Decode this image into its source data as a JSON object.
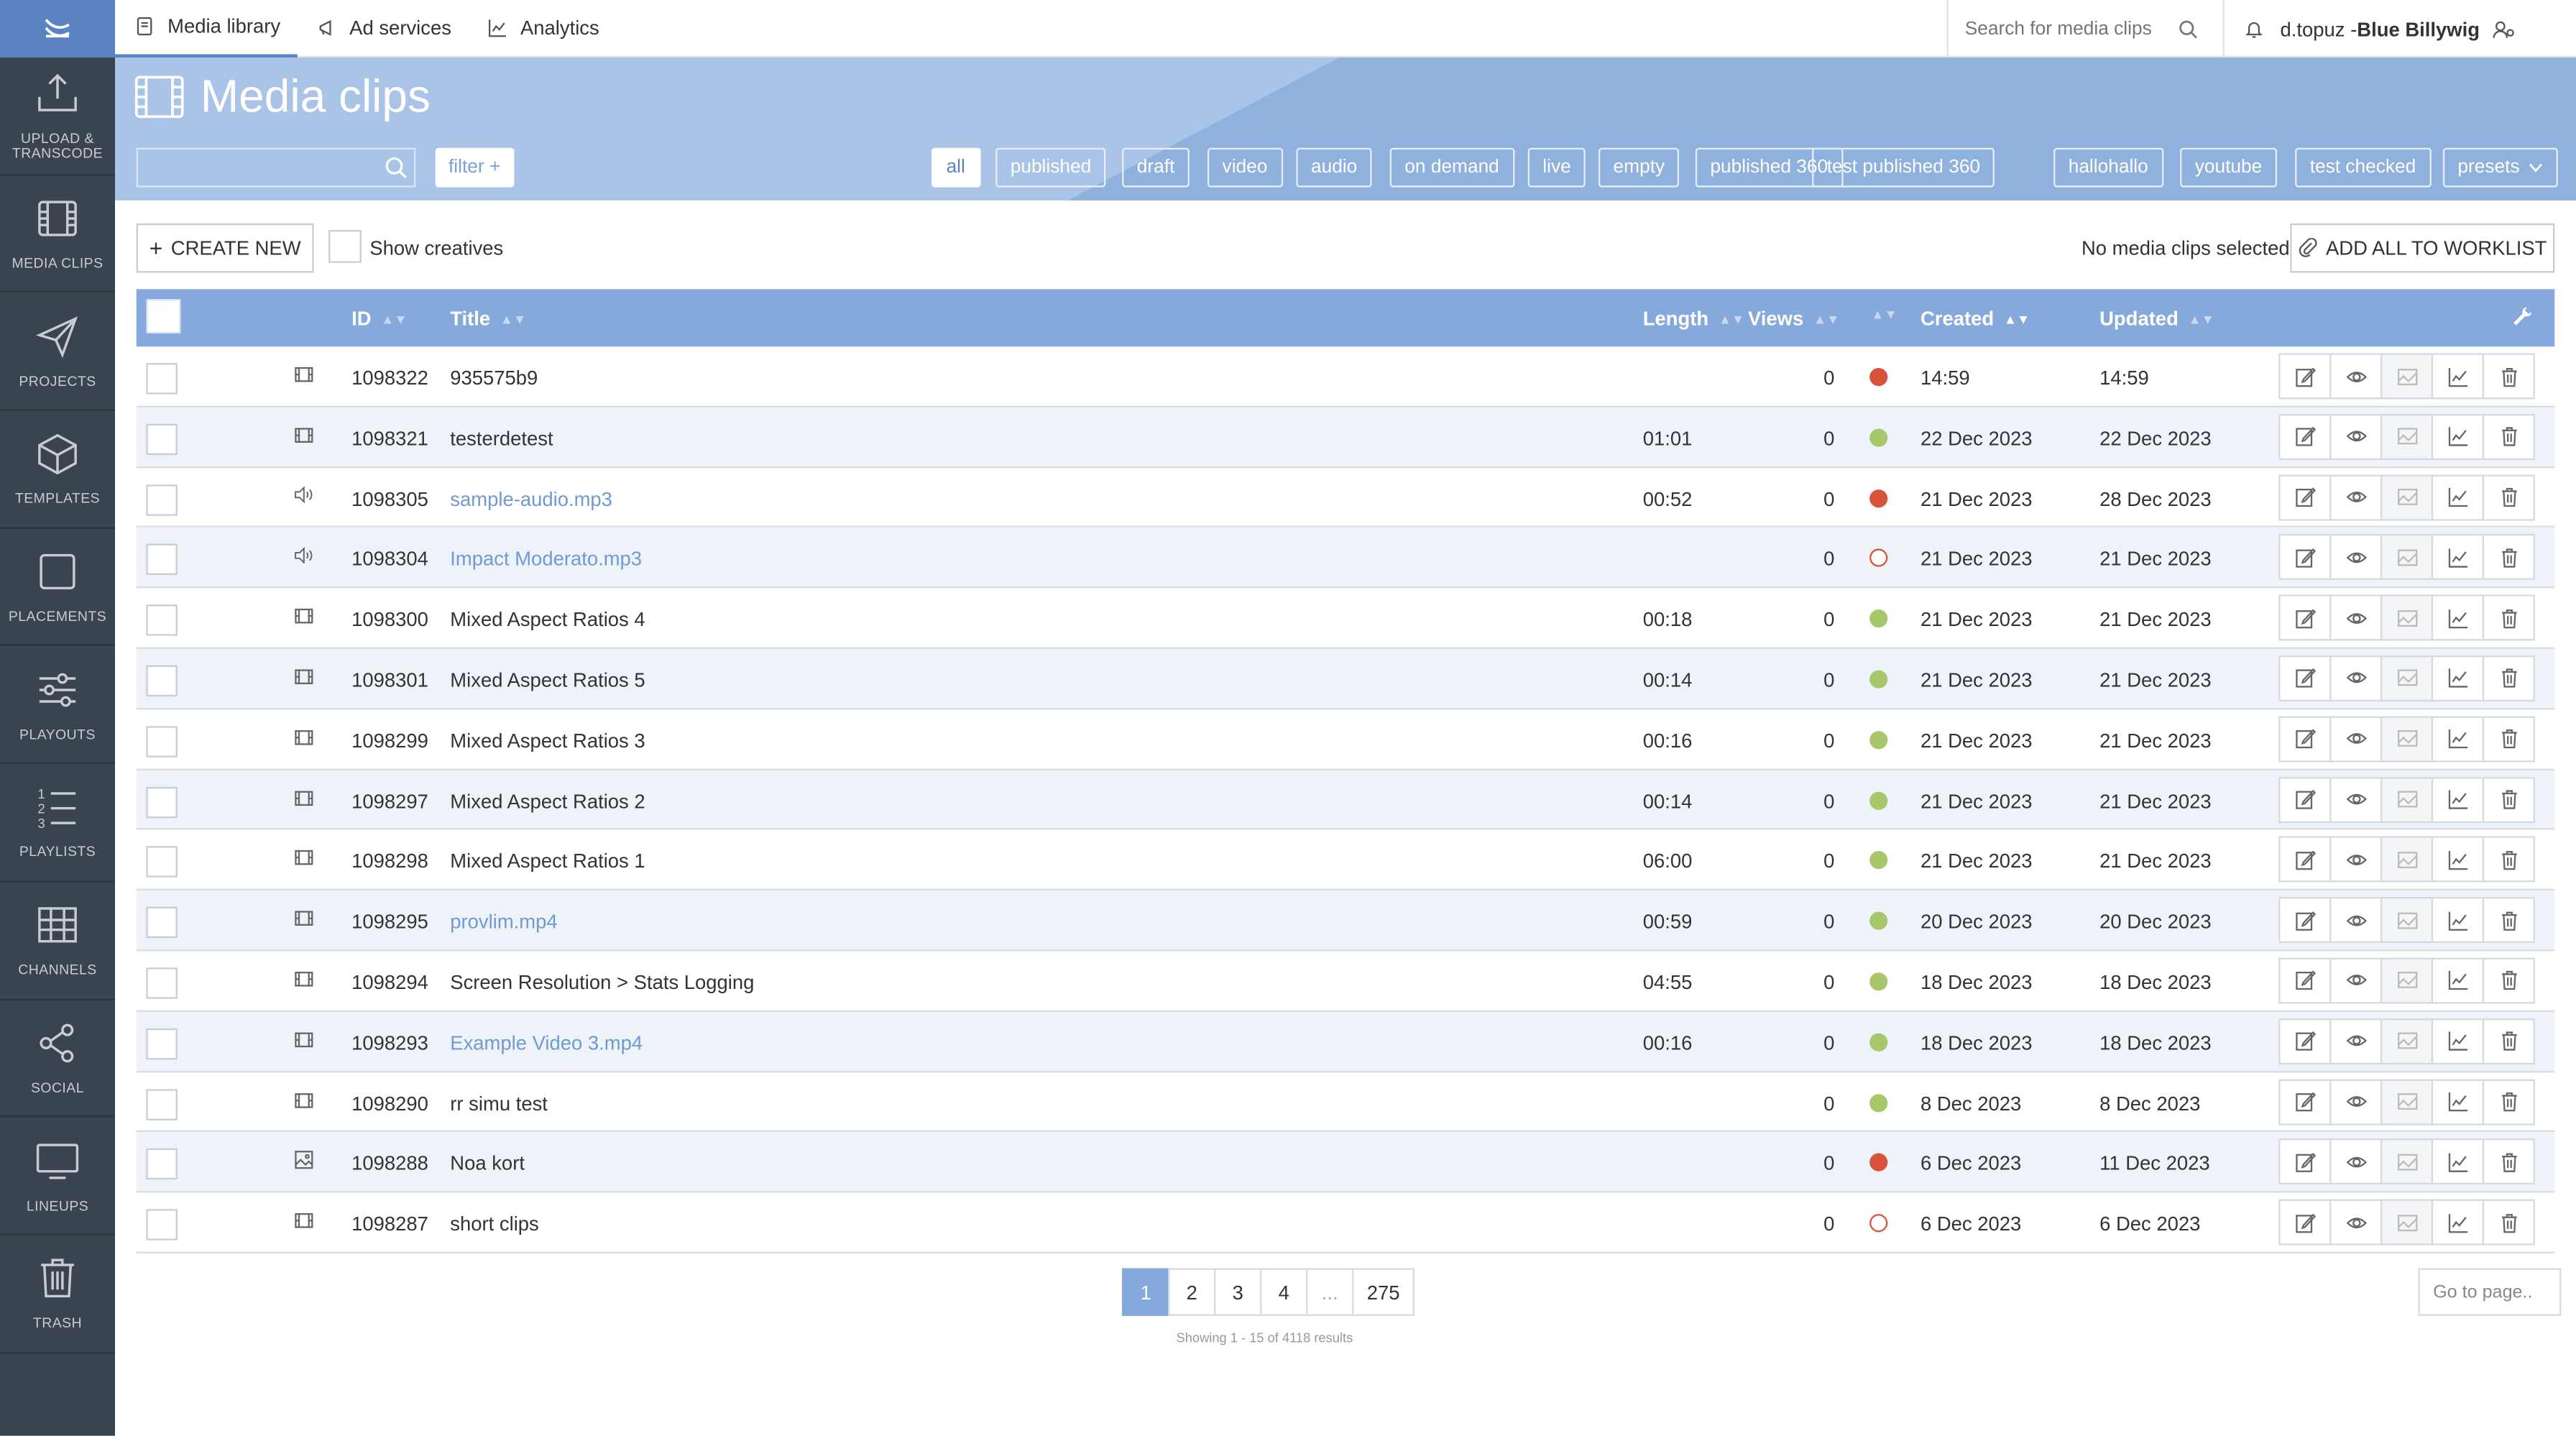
{
  "sidebar": {
    "items": [
      {
        "label": "UPLOAD &\nTRANSCODE",
        "icon": "upload-icon"
      },
      {
        "label": "MEDIA CLIPS",
        "icon": "film-icon"
      },
      {
        "label": "PROJECTS",
        "icon": "paper-plane-icon"
      },
      {
        "label": "TEMPLATES",
        "icon": "cube-icon"
      },
      {
        "label": "PLACEMENTS",
        "icon": "square-icon"
      },
      {
        "label": "PLAYOUTS",
        "icon": "sliders-icon"
      },
      {
        "label": "PLAYLISTS",
        "icon": "numbered-list-icon"
      },
      {
        "label": "CHANNELS",
        "icon": "grid-icon"
      },
      {
        "label": "SOCIAL",
        "icon": "share-icon"
      },
      {
        "label": "LINEUPS",
        "icon": "monitor-icon"
      },
      {
        "label": "TRASH",
        "icon": "trash-icon"
      }
    ]
  },
  "topbar": {
    "tabs": [
      {
        "label": "Media library",
        "icon": "book-icon"
      },
      {
        "label": "Ad services",
        "icon": "megaphone-icon"
      },
      {
        "label": "Analytics",
        "icon": "chart-icon"
      }
    ],
    "search_placeholder": "Search for media clips",
    "user_name": "d.topuz - ",
    "org_name": "Blue Billywig"
  },
  "header": {
    "title": "Media clips",
    "filter_label": "filter +",
    "filters": [
      "all",
      "published",
      "draft",
      "video",
      "audio",
      "on demand",
      "live",
      "empty",
      "published 360",
      "test published 360",
      "hallohallo",
      "youtube",
      "test checked",
      "presets"
    ]
  },
  "toolbar": {
    "create_label": "CREATE NEW",
    "show_creatives": "Show creatives",
    "selection_status": "No media clips selected",
    "worklist_label": "ADD ALL TO WORKLIST"
  },
  "table": {
    "columns": {
      "id": "ID",
      "title": "Title",
      "length": "Length",
      "views": "Views",
      "created": "Created",
      "updated": "Updated"
    },
    "rows": [
      {
        "type": "video",
        "id": "1098322",
        "title": "935575b9",
        "link": false,
        "length": "",
        "views": "0",
        "status": "red",
        "created": "14:59",
        "updated": "14:59"
      },
      {
        "type": "video",
        "id": "1098321",
        "title": "testerdetest",
        "link": false,
        "length": "01:01",
        "views": "0",
        "status": "green",
        "created": "22 Dec 2023",
        "updated": "22 Dec 2023"
      },
      {
        "type": "audio",
        "id": "1098305",
        "title": "sample-audio.mp3",
        "link": true,
        "length": "00:52",
        "views": "0",
        "status": "red",
        "created": "21 Dec 2023",
        "updated": "28 Dec 2023"
      },
      {
        "type": "audio",
        "id": "1098304",
        "title": "Impact Moderato.mp3",
        "link": true,
        "length": "",
        "views": "0",
        "status": "empty",
        "created": "21 Dec 2023",
        "updated": "21 Dec 2023"
      },
      {
        "type": "video",
        "id": "1098300",
        "title": "Mixed Aspect Ratios 4",
        "link": false,
        "length": "00:18",
        "views": "0",
        "status": "green",
        "created": "21 Dec 2023",
        "updated": "21 Dec 2023"
      },
      {
        "type": "video",
        "id": "1098301",
        "title": "Mixed Aspect Ratios 5",
        "link": false,
        "length": "00:14",
        "views": "0",
        "status": "green",
        "created": "21 Dec 2023",
        "updated": "21 Dec 2023"
      },
      {
        "type": "video",
        "id": "1098299",
        "title": "Mixed Aspect Ratios 3",
        "link": false,
        "length": "00:16",
        "views": "0",
        "status": "green",
        "created": "21 Dec 2023",
        "updated": "21 Dec 2023"
      },
      {
        "type": "video",
        "id": "1098297",
        "title": "Mixed Aspect Ratios 2",
        "link": false,
        "length": "00:14",
        "views": "0",
        "status": "green",
        "created": "21 Dec 2023",
        "updated": "21 Dec 2023"
      },
      {
        "type": "video",
        "id": "1098298",
        "title": "Mixed Aspect Ratios 1",
        "link": false,
        "length": "06:00",
        "views": "0",
        "status": "green",
        "created": "21 Dec 2023",
        "updated": "21 Dec 2023"
      },
      {
        "type": "video",
        "id": "1098295",
        "title": "provlim.mp4",
        "link": true,
        "length": "00:59",
        "views": "0",
        "status": "green",
        "created": "20 Dec 2023",
        "updated": "20 Dec 2023"
      },
      {
        "type": "video",
        "id": "1098294",
        "title": "Screen Resolution > Stats Logging",
        "link": false,
        "length": "04:55",
        "views": "0",
        "status": "green",
        "created": "18 Dec 2023",
        "updated": "18 Dec 2023"
      },
      {
        "type": "video",
        "id": "1098293",
        "title": "Example Video 3.mp4",
        "link": true,
        "length": "00:16",
        "views": "0",
        "status": "green",
        "created": "18 Dec 2023",
        "updated": "18 Dec 2023"
      },
      {
        "type": "video",
        "id": "1098290",
        "title": "rr simu test",
        "link": false,
        "length": "",
        "views": "0",
        "status": "green",
        "created": "8 Dec 2023",
        "updated": "8 Dec 2023"
      },
      {
        "type": "image",
        "id": "1098288",
        "title": "Noa kort",
        "link": false,
        "length": "",
        "views": "0",
        "status": "red",
        "created": "6 Dec 2023",
        "updated": "11 Dec 2023"
      },
      {
        "type": "video",
        "id": "1098287",
        "title": "short clips",
        "link": false,
        "length": "",
        "views": "0",
        "status": "empty",
        "created": "6 Dec 2023",
        "updated": "6 Dec 2023"
      }
    ]
  },
  "pagination": {
    "pages": [
      "1",
      "2",
      "3",
      "4",
      "...",
      "275"
    ],
    "current": "1",
    "results": "Showing 1 - 15 of 4118 results",
    "goto_placeholder": "Go to page.."
  },
  "colors": {
    "accent": "#5b82c3",
    "header_band": "#a9c4e6",
    "table_header": "#86a9db",
    "sidebar": "#3a4350",
    "status_red": "#d9533b",
    "status_green": "#a6c86a",
    "link": "#6f9ad4"
  }
}
